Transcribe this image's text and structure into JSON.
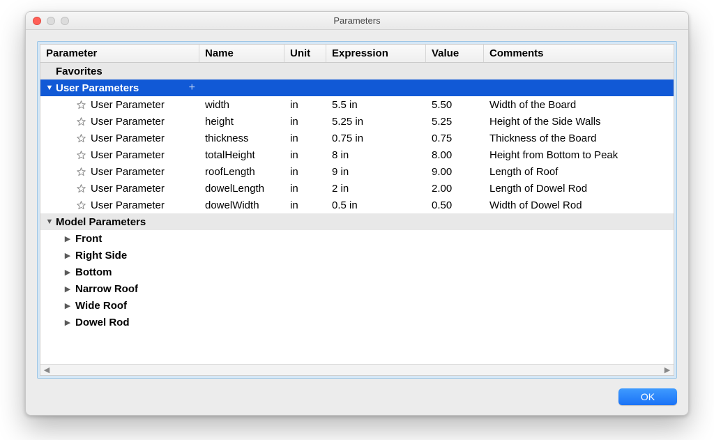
{
  "window": {
    "title": "Parameters"
  },
  "columns": {
    "parameter": "Parameter",
    "name": "Name",
    "unit": "Unit",
    "expression": "Expression",
    "value": "Value",
    "comments": "Comments"
  },
  "groups": {
    "favorites": {
      "label": "Favorites"
    },
    "user": {
      "label": "User Parameters"
    },
    "model": {
      "label": "Model Parameters"
    }
  },
  "userParams": [
    {
      "label": "User Parameter",
      "name": "width",
      "unit": "in",
      "expression": "5.5 in",
      "value": "5.50",
      "comments": "Width of the Board"
    },
    {
      "label": "User Parameter",
      "name": "height",
      "unit": "in",
      "expression": "5.25 in",
      "value": "5.25",
      "comments": "Height of the Side Walls"
    },
    {
      "label": "User Parameter",
      "name": "thickness",
      "unit": "in",
      "expression": "0.75 in",
      "value": "0.75",
      "comments": "Thickness of the Board"
    },
    {
      "label": "User Parameter",
      "name": "totalHeight",
      "unit": "in",
      "expression": "8 in",
      "value": "8.00",
      "comments": "Height from Bottom to Peak"
    },
    {
      "label": "User Parameter",
      "name": "roofLength",
      "unit": "in",
      "expression": "9 in",
      "value": "9.00",
      "comments": "Length of Roof"
    },
    {
      "label": "User Parameter",
      "name": "dowelLength",
      "unit": "in",
      "expression": "2 in",
      "value": "2.00",
      "comments": "Length of Dowel Rod"
    },
    {
      "label": "User Parameter",
      "name": "dowelWidth",
      "unit": "in",
      "expression": "0.5 in",
      "value": "0.50",
      "comments": "Width of Dowel Rod"
    }
  ],
  "modelGroups": [
    {
      "label": "Front"
    },
    {
      "label": "Right Side"
    },
    {
      "label": "Bottom"
    },
    {
      "label": "Narrow Roof"
    },
    {
      "label": "Wide Roof"
    },
    {
      "label": "Dowel Rod"
    }
  ],
  "buttons": {
    "ok": "OK"
  }
}
